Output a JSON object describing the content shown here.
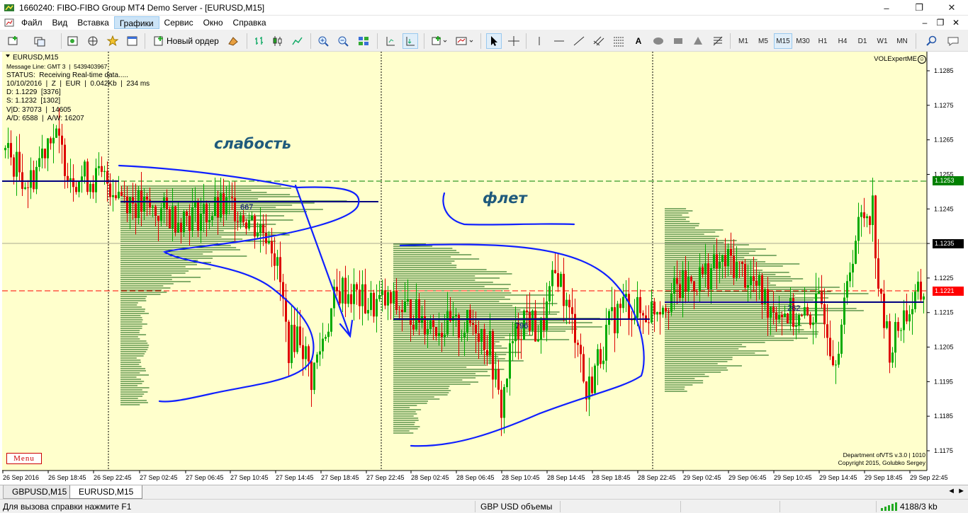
{
  "window": {
    "title": "1660240: FIBO-FIBO Group MT4 Demo Server - [EURUSD,M15]",
    "controls": [
      "–",
      "❐",
      "✕"
    ]
  },
  "menu": {
    "items": [
      "Файл",
      "Вид",
      "Вставка",
      "Графики",
      "Сервис",
      "Окно",
      "Справка"
    ],
    "active": "Графики"
  },
  "toolbar": {
    "new_order": "Новый ордер",
    "timeframes": [
      "M1",
      "M5",
      "M15",
      "M30",
      "H1",
      "H4",
      "D1",
      "W1",
      "MN"
    ],
    "selected_timeframe": "M15",
    "text_tool": "A"
  },
  "chart": {
    "symbol": "EURUSD,M15",
    "info_lines": [
      "Message Line: GMT 3  |  5439403967",
      "STATUS:  Receiving Real-time data.....",
      "10/10/2016  |  Z  |  EUR  |  0.042Kb  |  234 ms",
      "D: 1.1229  [3376]",
      "S: 1.1232  [1302]",
      "V|D: 37073  |  14605",
      "A/D: 6588  |  A/W: 16207"
    ],
    "expert": "VOLExpertME",
    "menu_button": "Menu",
    "copyright": [
      "Department ofVTS  v.3.0 | 1010",
      "Copyright 2015, Golubko Sergey"
    ],
    "annotations": {
      "weakness": "слабость",
      "flat": "флет"
    },
    "profile_labels": [
      "667",
      "796",
      "262"
    ],
    "price_ticks": [
      "1.1285",
      "1.1275",
      "1.1265",
      "1.1255",
      "1.1245",
      "1.1235",
      "1.1225",
      "1.1215",
      "1.1205",
      "1.1195",
      "1.1185",
      "1.1175"
    ],
    "price_labels": {
      "green": "1.1253",
      "black": "1.1235",
      "red": "1.1221"
    },
    "time_labels": [
      "26 Sep 2016",
      "26 Sep 18:45",
      "26 Sep 22:45",
      "27 Sep 02:45",
      "27 Sep 06:45",
      "27 Sep 10:45",
      "27 Sep 14:45",
      "27 Sep 18:45",
      "27 Sep 22:45",
      "28 Sep 02:45",
      "28 Sep 06:45",
      "28 Sep 10:45",
      "28 Sep 14:45",
      "28 Sep 18:45",
      "28 Sep 22:45",
      "29 Sep 02:45",
      "29 Sep 06:45",
      "29 Sep 10:45",
      "29 Sep 14:45",
      "29 Sep 18:45",
      "29 Sep 22:45"
    ],
    "colors": {
      "background": "#ffffcc",
      "bull": "#00aa00",
      "bear": "#dd0000",
      "profile": "#0a5c0a",
      "poc": "#000080",
      "drawing": "#1020ff",
      "green_level": "#008000",
      "red_level": "#ff0000"
    }
  },
  "tabs": {
    "items": [
      "GBPUSD,M15",
      "EURUSD,M15"
    ],
    "active": "EURUSD,M15",
    "nav": "◄ ►"
  },
  "status": {
    "help": "Для вызова справки нажмите F1",
    "profile": "GBP USD объемы",
    "traffic": "4188/3 kb"
  }
}
